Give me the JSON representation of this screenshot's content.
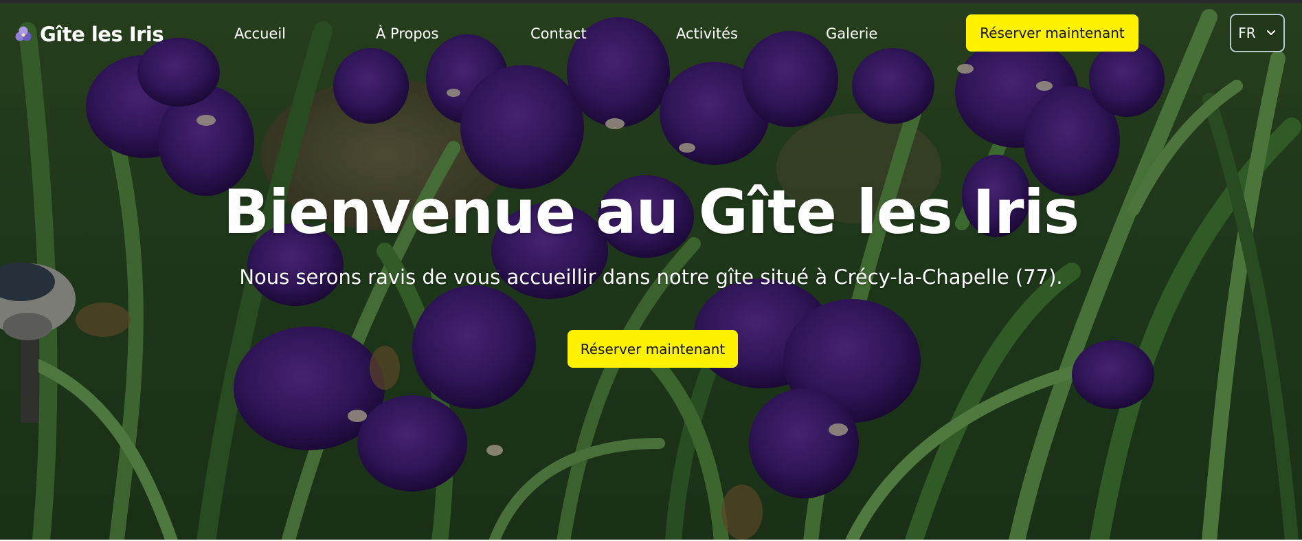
{
  "brand": {
    "name": "Gîte les Iris",
    "icon": "iris-flower-icon"
  },
  "nav": {
    "items": [
      {
        "label": "Accueil"
      },
      {
        "label": "À Propos"
      },
      {
        "label": "Contact"
      },
      {
        "label": "Activités"
      },
      {
        "label": "Galerie"
      }
    ],
    "cta_label": "Réserver maintenant",
    "language": {
      "selected": "FR",
      "icon": "chevron-down-icon"
    }
  },
  "hero": {
    "title": "Bienvenue au Gîte les Iris",
    "subtitle": "Nous serons ravis de vous accueillir dans notre gîte situé à Crécy-la-Chapelle (77).",
    "cta_label": "Réserver maintenant",
    "background": "iris-garden-photo"
  },
  "colors": {
    "accent": "#fff200",
    "text_on_hero": "#ffffff",
    "iris_purple": "#3d1a6e",
    "foliage_green": "#2f5a2a"
  }
}
